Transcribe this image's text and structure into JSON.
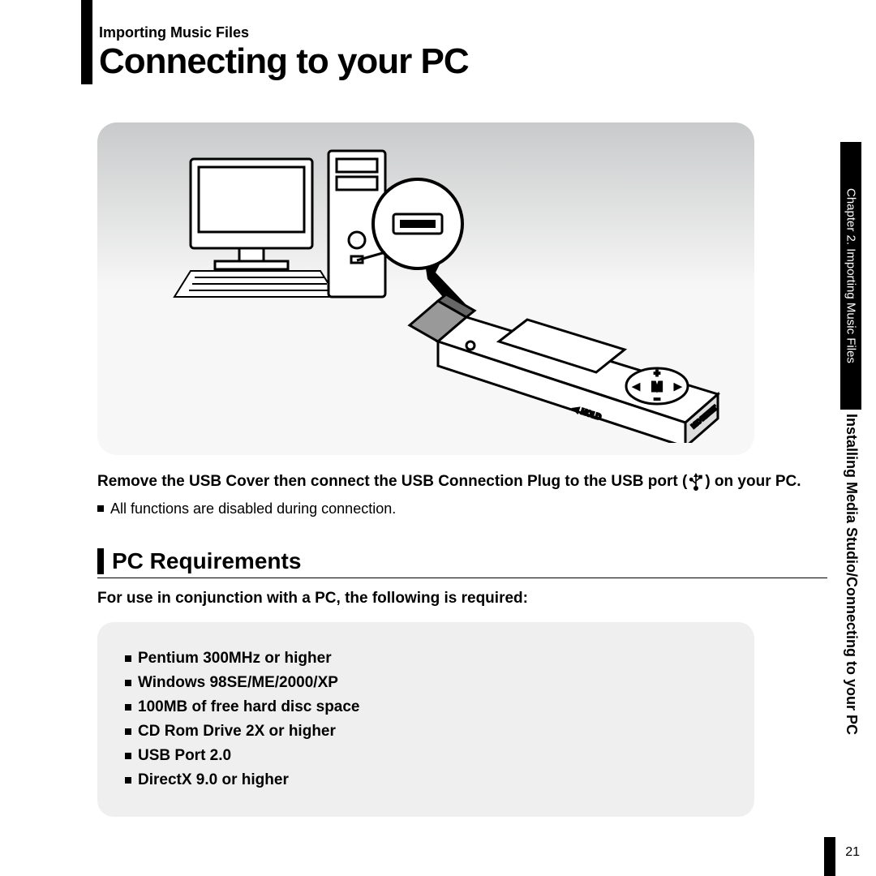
{
  "header": {
    "breadcrumb": "Importing Music Files",
    "title": "Connecting to your PC"
  },
  "instruction": {
    "pre": "Remove the USB Cover then connect the USB Connection Plug to the USB port (",
    "post": ") on your PC."
  },
  "note": "All functions are disabled during connection.",
  "section": {
    "title": "PC Requirements",
    "intro": "For use in conjunction with a PC, the following is required:",
    "items": [
      "Pentium 300MHz or higher",
      "Windows 98SE/ME/2000/XP",
      "100MB of free hard disc space",
      "CD Rom Drive 2X or higher",
      "USB Port 2.0",
      "DirectX 9.0 or higher"
    ]
  },
  "side": {
    "tab": "Chapter 2. Importing Music Files",
    "trail": "Installing Media Studio/Connecting to your PC"
  },
  "page_number": "21"
}
